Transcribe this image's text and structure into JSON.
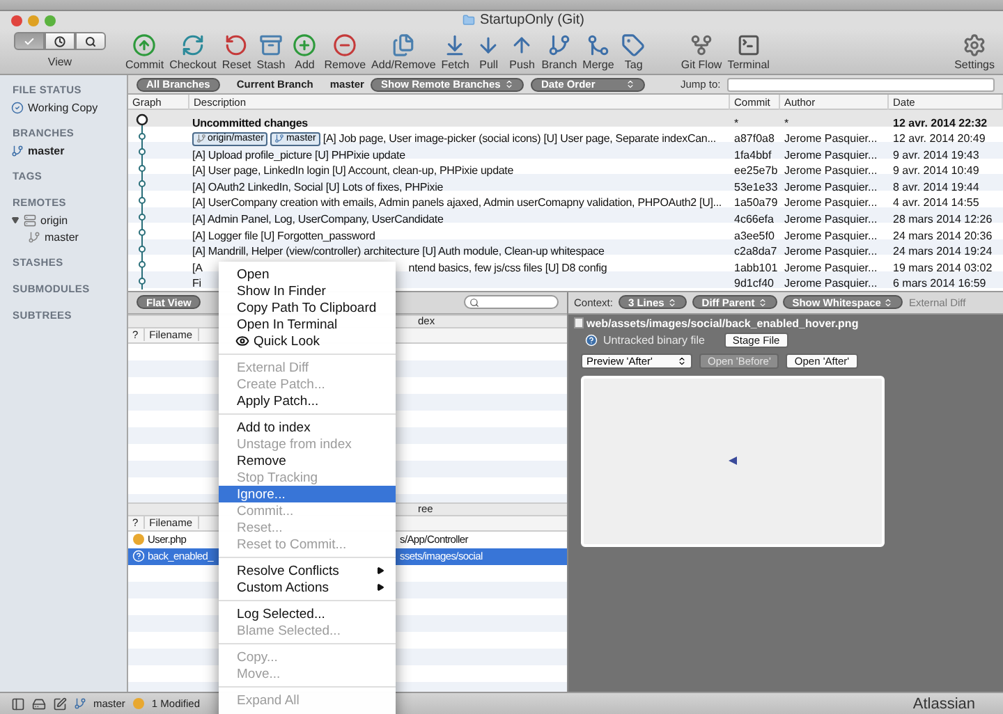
{
  "window": {
    "title": "StartupOnly (Git)"
  },
  "toolbar": {
    "view_label": "View",
    "view_modes": [
      {
        "kind": "check",
        "selected": true
      },
      {
        "kind": "clock",
        "selected": false
      },
      {
        "kind": "search",
        "selected": false
      }
    ],
    "buttons": [
      {
        "label": "Commit",
        "kind": "commit"
      },
      {
        "label": "Checkout",
        "kind": "checkout"
      },
      {
        "label": "Reset",
        "kind": "reset"
      },
      {
        "label": "Stash",
        "kind": "stash"
      },
      {
        "label": "Add",
        "kind": "add"
      },
      {
        "label": "Remove",
        "kind": "remove"
      },
      {
        "label": "Add/Remove",
        "kind": "addremove"
      },
      {
        "label": "Fetch",
        "kind": "fetch"
      },
      {
        "label": "Pull",
        "kind": "pull"
      },
      {
        "label": "Push",
        "kind": "push"
      },
      {
        "label": "Branch",
        "kind": "branch"
      },
      {
        "label": "Merge",
        "kind": "merge"
      },
      {
        "label": "Tag",
        "kind": "tag"
      }
    ],
    "extra_buttons": [
      {
        "label": "Git Flow",
        "kind": "gitflow"
      },
      {
        "label": "Terminal",
        "kind": "terminal"
      }
    ],
    "settings": {
      "label": "Settings",
      "kind": "settings"
    }
  },
  "sidebar": {
    "sections": [
      {
        "title": "FILE STATUS",
        "items": [
          {
            "label": "Working Copy",
            "kind": "check"
          }
        ]
      },
      {
        "title": "BRANCHES",
        "items": [
          {
            "label": "master",
            "kind": "branch",
            "current": true
          }
        ]
      },
      {
        "title": "TAGS"
      },
      {
        "title": "REMOTES",
        "items": [
          {
            "label": "origin",
            "kind": "server",
            "expanded": true,
            "children": [
              {
                "label": "master",
                "kind": "remote-branch"
              }
            ]
          }
        ]
      },
      {
        "title": "STASHES"
      },
      {
        "title": "SUBMODULES"
      },
      {
        "title": "SUBTREES"
      }
    ]
  },
  "filter_bar": {
    "scopes": [
      {
        "label": "All Branches",
        "selected": true
      },
      {
        "label": "Current Branch",
        "selected": false
      }
    ],
    "current_branch": "master",
    "remote_select": "Show Remote Branches",
    "order_select": "Date Order",
    "jump_label": "Jump to:"
  },
  "commits": {
    "columns": [
      "Graph",
      "Description",
      "Commit",
      "Author",
      "Date"
    ],
    "rows": [
      {
        "kind": "uncommitted",
        "description": "Uncommitted changes",
        "commit": "*",
        "author": "*",
        "date": "12 avr. 2014 22:32"
      },
      {
        "kind": "commit",
        "tags": [
          {
            "label": "origin/master",
            "kind": "remote"
          },
          {
            "label": "master",
            "kind": "local"
          }
        ],
        "description": "[A] Job page, User image-picker (social icons) [U] User page, Separate indexCan...",
        "commit": "a87f0a8",
        "author": "Jerome Pasquier...",
        "date": "12 avr. 2014 20:49"
      },
      {
        "kind": "commit",
        "description": "[A] Upload profile_picture [U] PHPixie update",
        "commit": "1fa4bbf",
        "author": "Jerome Pasquier...",
        "date": "9 avr. 2014 19:43"
      },
      {
        "kind": "commit",
        "description": "[A] User page, LinkedIn login [U] Account, clean-up, PHPixie update",
        "commit": "ee25e7b",
        "author": "Jerome Pasquier...",
        "date": "9 avr. 2014 10:49"
      },
      {
        "kind": "commit",
        "description": "[A] OAuth2 LinkedIn, Social [U] Lots of fixes, PHPixie",
        "commit": "53e1e33",
        "author": "Jerome Pasquier...",
        "date": "8 avr. 2014 19:44"
      },
      {
        "kind": "commit",
        "description": "[A] UserCompany creation with emails, Admin panels ajaxed, Admin userComapny validation, PHPOAuth2 [U]...",
        "commit": "1a50a79",
        "author": "Jerome Pasquier...",
        "date": "4 avr. 2014 14:55"
      },
      {
        "kind": "commit",
        "description": "[A] Admin Panel, Log, UserCompany, UserCandidate",
        "commit": "4c66efa",
        "author": "Jerome Pasquier...",
        "date": "28 mars 2014 12:26"
      },
      {
        "kind": "commit",
        "description": "[A] Logger file [U] Forgotten_password",
        "commit": "a3ee5f0",
        "author": "Jerome Pasquier...",
        "date": "24 mars 2014 20:36"
      },
      {
        "kind": "commit",
        "description": "[A] Mandrill, Helper (view/controller) architecture [U] Auth module, Clean-up whitespace",
        "commit": "c2a8da7",
        "author": "Jerome Pasquier...",
        "date": "24 mars 2014 19:24"
      },
      {
        "kind": "commit",
        "description": "[A",
        "description_tail": "ntend basics, few js/css files [U] D8 config",
        "commit": "1abb101",
        "author": "Jerome Pasquier...",
        "date": "19 mars 2014 03:02"
      },
      {
        "kind": "commit",
        "description": "Fi",
        "commit": "9d1cf40",
        "author": "Jerome Pasquier...",
        "date": "6 mars 2014 16:59"
      }
    ]
  },
  "files": {
    "view_button": "Flat View",
    "staged": {
      "header": "dex",
      "columns": [
        "?",
        "Filename"
      ]
    },
    "working": {
      "header": "ree",
      "columns": [
        "?",
        "Filename"
      ],
      "rows": [
        {
          "kind": "modified",
          "filename": "User.php",
          "path": "s/App/Controller",
          "selected": false
        },
        {
          "kind": "untracked",
          "filename": "back_enabled_",
          "path": "ssets/images/social",
          "selected": true
        }
      ]
    }
  },
  "diff": {
    "context_label": "Context:",
    "selects": [
      "3 Lines",
      "Diff Parent",
      "Show Whitespace"
    ],
    "external_diff": "External Diff",
    "path": "web/assets/images/social/back_enabled_hover.png",
    "status": "Untracked binary file",
    "stage_button": "Stage File",
    "preview_select": "Preview 'After'",
    "buttons": [
      {
        "label": "Open 'Before'",
        "disabled": true
      },
      {
        "label": "Open 'After'",
        "disabled": false
      }
    ]
  },
  "context_menu": {
    "groups": [
      [
        {
          "label": "Open",
          "kind": "plain",
          "disabled": false,
          "selected": false
        },
        {
          "label": "Show In Finder",
          "kind": "plain",
          "disabled": false,
          "selected": false
        },
        {
          "label": "Copy Path To Clipboard",
          "kind": "plain",
          "disabled": false,
          "selected": false
        },
        {
          "label": "Open In Terminal",
          "kind": "plain",
          "disabled": false,
          "selected": false
        },
        {
          "label": "Quick Look",
          "kind": "eye",
          "disabled": false,
          "selected": false
        }
      ],
      [
        {
          "label": "External Diff",
          "kind": "plain",
          "disabled": true,
          "selected": false
        },
        {
          "label": "Create Patch...",
          "kind": "plain",
          "disabled": true,
          "selected": false
        },
        {
          "label": "Apply Patch...",
          "kind": "plain",
          "disabled": false,
          "selected": false
        }
      ],
      [
        {
          "label": "Add to index",
          "kind": "plain",
          "disabled": false,
          "selected": false
        },
        {
          "label": "Unstage from index",
          "kind": "plain",
          "disabled": true,
          "selected": false
        },
        {
          "label": "Remove",
          "kind": "plain",
          "disabled": false,
          "selected": false
        },
        {
          "label": "Stop Tracking",
          "kind": "plain",
          "disabled": true,
          "selected": false
        },
        {
          "label": "Ignore...",
          "kind": "plain",
          "disabled": false,
          "selected": true
        },
        {
          "label": "Commit...",
          "kind": "plain",
          "disabled": true,
          "selected": false
        },
        {
          "label": "Reset...",
          "kind": "plain",
          "disabled": true,
          "selected": false
        },
        {
          "label": "Reset to Commit...",
          "kind": "plain",
          "disabled": true,
          "selected": false
        }
      ],
      [
        {
          "label": "Resolve Conflicts",
          "kind": "submenu",
          "disabled": false,
          "selected": false
        },
        {
          "label": "Custom Actions",
          "kind": "submenu",
          "disabled": false,
          "selected": false
        }
      ],
      [
        {
          "label": "Log Selected...",
          "kind": "plain",
          "disabled": false,
          "selected": false
        },
        {
          "label": "Blame Selected...",
          "kind": "plain",
          "disabled": true,
          "selected": false
        }
      ],
      [
        {
          "label": "Copy...",
          "kind": "plain",
          "disabled": true,
          "selected": false
        },
        {
          "label": "Move...",
          "kind": "plain",
          "disabled": true,
          "selected": false
        }
      ],
      [
        {
          "label": "Expand All",
          "kind": "plain",
          "disabled": true,
          "selected": false
        }
      ]
    ]
  },
  "status_bar": {
    "branch": "master",
    "modified": "1 Modified",
    "brand": "Atlassian"
  }
}
